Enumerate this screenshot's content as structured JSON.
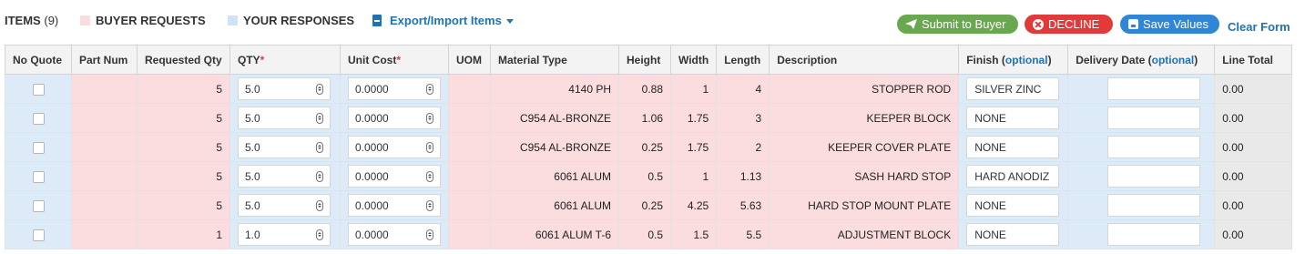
{
  "header": {
    "items_label": "ITEMS",
    "items_count": "(9)",
    "legend_buyer": "BUYER REQUESTS",
    "legend_responses": "YOUR RESPONSES",
    "export_label": "Export/Import Items",
    "submit_label": "Submit to Buyer",
    "decline_label": "DECLINE",
    "save_label": "Save Values",
    "clear_label": "Clear Form"
  },
  "colors": {
    "buyer_bg": "#fbdde0",
    "response_bg": "#dcebf7",
    "submit": "#6aa84f",
    "decline": "#e23a3a",
    "save": "#2f86d6",
    "link": "#1d73b3"
  },
  "icons": {
    "export": "file-icon",
    "submit": "paper-plane-icon",
    "decline": "x-circle-icon",
    "save": "floppy-disk-icon"
  },
  "columns": {
    "no_quote": "No Quote",
    "part_num": "Part Num",
    "requested_qty": "Requested Qty",
    "qty": "QTY",
    "unit_cost": "Unit Cost",
    "uom": "UOM",
    "material_type": "Material Type",
    "height": "Height",
    "width": "Width",
    "length": "Length",
    "description": "Description",
    "finish": "Finish",
    "delivery_date": "Delivery Date",
    "line_total": "Line Total",
    "required_mark": "*",
    "optional": "optional"
  },
  "rows": [
    {
      "requested_qty": "5",
      "qty": "5.0",
      "unit_cost": "0.0000",
      "uom": "",
      "material": "4140 PH",
      "height": "0.88",
      "width": "1",
      "length": "4",
      "description": "STOPPER ROD",
      "finish": "SILVER ZINC",
      "delivery": "",
      "line_total": "0.00"
    },
    {
      "requested_qty": "5",
      "qty": "5.0",
      "unit_cost": "0.0000",
      "uom": "",
      "material": "C954 AL-BRONZE",
      "height": "1.06",
      "width": "1.75",
      "length": "3",
      "description": "KEEPER BLOCK",
      "finish": "NONE",
      "delivery": "",
      "line_total": "0.00"
    },
    {
      "requested_qty": "5",
      "qty": "5.0",
      "unit_cost": "0.0000",
      "uom": "",
      "material": "C954 AL-BRONZE",
      "height": "0.25",
      "width": "1.75",
      "length": "2",
      "description": "KEEPER COVER PLATE",
      "finish": "NONE",
      "delivery": "",
      "line_total": "0.00"
    },
    {
      "requested_qty": "5",
      "qty": "5.0",
      "unit_cost": "0.0000",
      "uom": "",
      "material": "6061 ALUM",
      "height": "0.5",
      "width": "1",
      "length": "1.13",
      "description": "SASH HARD STOP",
      "finish": "HARD ANODIZ",
      "delivery": "",
      "line_total": "0.00"
    },
    {
      "requested_qty": "5",
      "qty": "5.0",
      "unit_cost": "0.0000",
      "uom": "",
      "material": "6061 ALUM",
      "height": "0.25",
      "width": "4.25",
      "length": "5.63",
      "description": "HARD STOP MOUNT PLATE",
      "finish": "NONE",
      "delivery": "",
      "line_total": "0.00"
    },
    {
      "requested_qty": "1",
      "qty": "1.0",
      "unit_cost": "0.0000",
      "uom": "",
      "material": "6061 ALUM T-6",
      "height": "0.5",
      "width": "1.5",
      "length": "5.5",
      "description": "ADJUSTMENT BLOCK",
      "finish": "NONE",
      "delivery": "",
      "line_total": "0.00"
    }
  ]
}
